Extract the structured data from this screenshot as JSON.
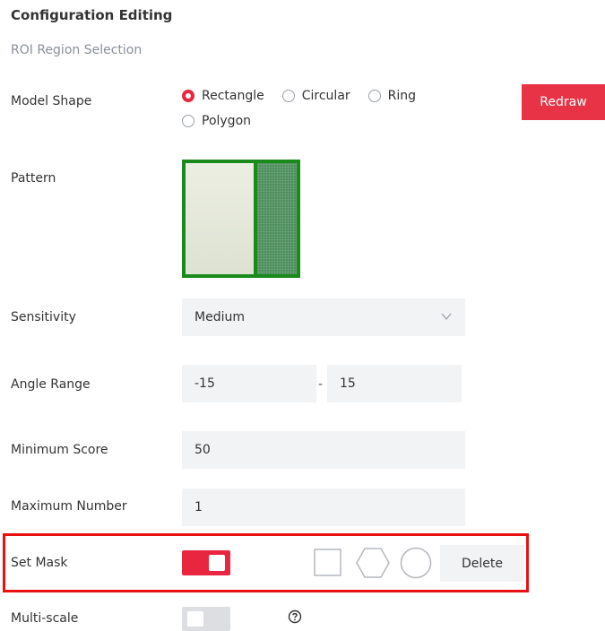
{
  "header": {
    "title": "Configuration Editing",
    "subtitle": "ROI Region Selection"
  },
  "model_shape": {
    "label": "Model Shape",
    "options": [
      {
        "label": "Rectangle",
        "checked": true
      },
      {
        "label": "Circular",
        "checked": false
      },
      {
        "label": "Ring",
        "checked": false
      },
      {
        "label": "Polygon",
        "checked": false
      }
    ],
    "redraw_label": "Redraw"
  },
  "pattern": {
    "label": "Pattern"
  },
  "sensitivity": {
    "label": "Sensitivity",
    "value": "Medium"
  },
  "angle_range": {
    "label": "Angle Range",
    "min": "-15",
    "separator": "-",
    "max": "15"
  },
  "minimum_score": {
    "label": "Minimum Score",
    "value": "50"
  },
  "maximum_number": {
    "label": "Maximum Number",
    "value": "1"
  },
  "set_mask": {
    "label": "Set Mask",
    "enabled": true,
    "tools": [
      "rectangle-mask-icon",
      "polygon-mask-icon",
      "circle-mask-icon"
    ],
    "delete_label": "Delete"
  },
  "multi_scale": {
    "label": "Multi-scale",
    "enabled": false,
    "help_icon": "help-circle-icon"
  },
  "colors": {
    "accent": "#e8263f",
    "highlight_border": "#e81010",
    "pattern_border": "#1a8a1a"
  }
}
